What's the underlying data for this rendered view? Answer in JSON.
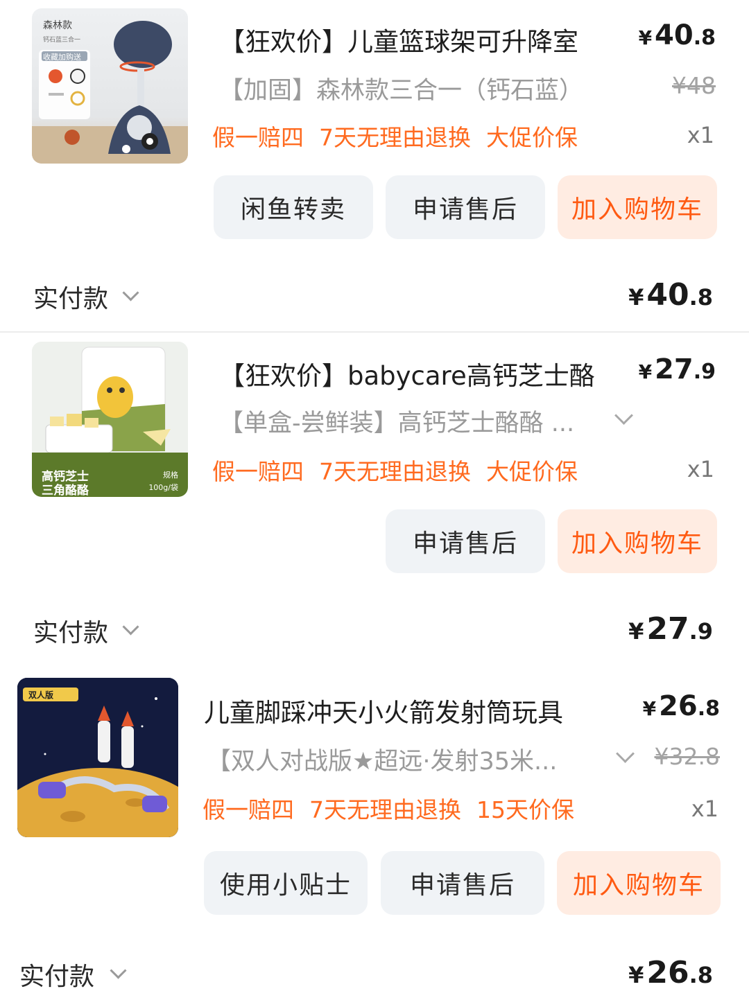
{
  "orders": [
    {
      "title": "【狂欢价】儿童篮球架可升降室",
      "variant": "【加固】森林款三合一（钙石蓝）",
      "tags": [
        "假一赔四",
        "7天无理由退换",
        "大促价保"
      ],
      "price": {
        "yen": "¥",
        "int": "40",
        "dec": ".8"
      },
      "original_price": "¥48",
      "quantity": "x1",
      "buttons": [
        "闲鱼转卖",
        "申请售后",
        "加入购物车"
      ],
      "paid_label": "实付款",
      "paid": {
        "yen": "¥",
        "int": "40",
        "dec": ".8"
      },
      "thumb_text": {
        "top": "森林款",
        "sub": "钙石蓝三合一",
        "badge": "收藏加购送"
      }
    },
    {
      "title": "【狂欢价】babycare高钙芝士酪",
      "variant": "【单盒-尝鲜装】高钙芝士酪酪 ...",
      "tags": [
        "假一赔四",
        "7天无理由退换",
        "大促价保"
      ],
      "price": {
        "yen": "¥",
        "int": "27",
        "dec": ".9"
      },
      "quantity": "x1",
      "buttons": [
        "申请售后",
        "加入购物车"
      ],
      "paid_label": "实付款",
      "paid": {
        "yen": "¥",
        "int": "27",
        "dec": ".9"
      },
      "thumb_text": {
        "line1": "高钙芝士",
        "line2": "三角酪酪",
        "spec_label": "规格",
        "spec": "100g/袋"
      }
    },
    {
      "title": "儿童脚踩冲天小火箭发射筒玩具",
      "variant": "【双人对战版★超远·发射35米...",
      "tags": [
        "假一赔四",
        "7天无理由退换",
        "15天价保"
      ],
      "price": {
        "yen": "¥",
        "int": "26",
        "dec": ".8"
      },
      "original_price": "¥32.8",
      "quantity": "x1",
      "buttons": [
        "使用小贴士",
        "申请售后",
        "加入购物车"
      ],
      "paid_label": "实付款",
      "paid": {
        "yen": "¥",
        "int": "26",
        "dec": ".8"
      },
      "thumb_text": {
        "badge": "双人版"
      }
    }
  ],
  "colors": {
    "accent": "#ff5a12",
    "tag": "#ff6a1f",
    "button_bg": "#f0f3f6",
    "primary_bg": "#ffece2"
  }
}
